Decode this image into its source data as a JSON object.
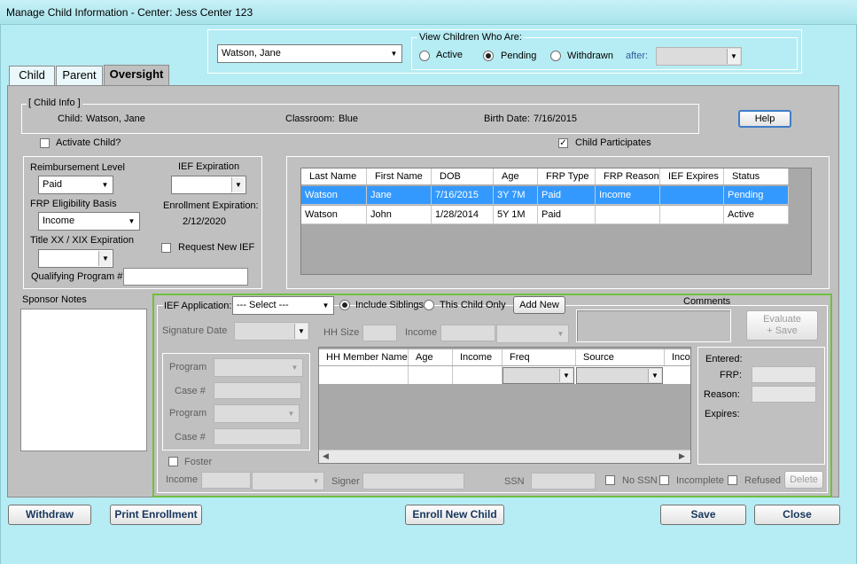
{
  "window": {
    "title": "Manage Child Information - Center: Jess Center  123"
  },
  "child_selector": {
    "value": "Watson, Jane"
  },
  "view_group": {
    "legend": "View Children Who Are:",
    "options": [
      "Active",
      "Pending",
      "Withdrawn"
    ],
    "selected": "Pending",
    "after_label": "after:"
  },
  "tabs": [
    "Child",
    "Parent",
    "Oversight"
  ],
  "active_tab": "Oversight",
  "child_info": {
    "legend": "[ Child Info ]",
    "child_label": "Child:",
    "child_value": "Watson, Jane",
    "classroom_label": "Classroom:",
    "classroom_value": "Blue",
    "birth_label": "Birth Date:",
    "birth_value": "7/16/2015"
  },
  "help_button": "Help",
  "activate_child": "Activate Child?",
  "child_participates": "Child Participates",
  "reimbursement": {
    "level_label": "Reimbursement Level",
    "level_value": "Paid",
    "ief_expiration_label": "IEF Expiration",
    "frp_basis_label": "FRP Eligibility Basis",
    "frp_basis_value": "Income",
    "enrollment_expiration_label": "Enrollment Expiration:",
    "enrollment_expiration_value": "2/12/2020",
    "title_xx_label": "Title XX / XIX Expiration",
    "request_new_ief": "Request New IEF",
    "qualifying_label": "Qualifying Program #"
  },
  "children_table": {
    "columns": [
      "Last Name",
      "First Name",
      "DOB",
      "Age",
      "FRP Type",
      "FRP Reason",
      "IEF Expires",
      "Status"
    ],
    "rows": [
      [
        "Watson",
        "Jane",
        "7/16/2015",
        "3Y 7M",
        "Paid",
        "Income",
        "",
        "Pending"
      ],
      [
        "Watson",
        "John",
        "1/28/2014",
        "5Y 1M",
        "Paid",
        "",
        "",
        "Active"
      ]
    ]
  },
  "sponsor_notes_label": "Sponsor Notes",
  "ief": {
    "application_label": "IEF Application:",
    "application_value": "--- Select ---",
    "include_siblings": "Include Siblings",
    "this_child_only": "This Child Only",
    "add_new": "Add New",
    "comments_label": "Comments",
    "evaluate_save_1": "Evaluate",
    "evaluate_save_2": "+ Save",
    "signature_date_label": "Signature Date",
    "hh_size_label": "HH Size",
    "income_label": "Income",
    "program_label": "Program",
    "case_label": "Case #",
    "hh_columns": [
      "HH Member Name",
      "Age",
      "Income",
      "Freq",
      "Source",
      "Incom"
    ],
    "entered_label": "Entered:",
    "frp_label": "FRP:",
    "reason_label": "Reason:",
    "expires_label": "Expires:",
    "foster_label": "Foster",
    "bottom_income_label": "Income",
    "signer_label": "Signer",
    "ssn_label": "SSN",
    "no_ssn": "No SSN",
    "incomplete": "Incomplete",
    "refused": "Refused",
    "delete": "Delete"
  },
  "footer": {
    "withdraw": "Withdraw",
    "print_enrollment": "Print Enrollment",
    "enroll_new_child": "Enroll New Child",
    "save": "Save",
    "close": "Close"
  },
  "colors": {
    "window_bg": "#b6ecf3",
    "panel_bg": "#c0c0c0",
    "selection": "#3399ff",
    "ief_border": "#6fbf3f"
  }
}
